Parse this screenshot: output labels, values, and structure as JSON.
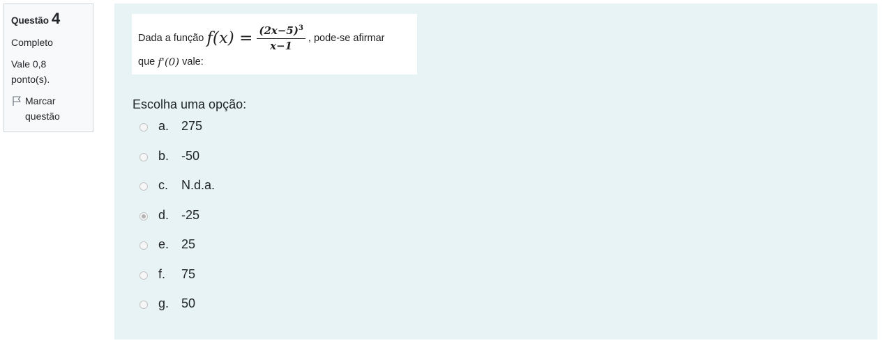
{
  "info": {
    "question_label": "Questão",
    "question_number": "4",
    "state": "Completo",
    "grade": "Vale 0,8 ponto(s).",
    "flag_label": "Marcar questão",
    "flag_icon": "flag-icon"
  },
  "question": {
    "text_before": "Dada a função",
    "function_lhs": "f(x) =",
    "numerator": "(2x−5)",
    "exponent": "3",
    "denominator": "x−1",
    "text_after": ", pode-se afirmar",
    "line2_before": "que",
    "derivative": "f'(0)",
    "line2_after": "vale:"
  },
  "prompt": "Escolha uma opção:",
  "options": [
    {
      "letter": "a.",
      "value": "275",
      "checked": false
    },
    {
      "letter": "b.",
      "value": "-50",
      "checked": false
    },
    {
      "letter": "c.",
      "value": "N.d.a.",
      "checked": false
    },
    {
      "letter": "d.",
      "value": "-25",
      "checked": true
    },
    {
      "letter": "e.",
      "value": "25",
      "checked": false
    },
    {
      "letter": "f.",
      "value": "75",
      "checked": false
    },
    {
      "letter": "g.",
      "value": "50",
      "checked": false
    }
  ],
  "colors": {
    "content_bg": "#e7f3f5",
    "info_bg": "#f8f9fa",
    "info_border": "#ced4da"
  }
}
